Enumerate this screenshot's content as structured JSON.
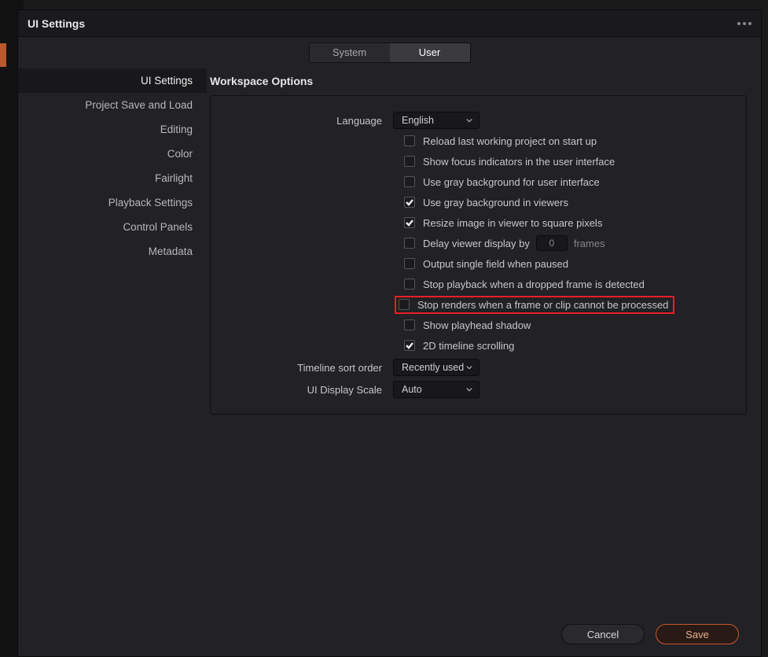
{
  "window": {
    "title": "UI Settings"
  },
  "tabs": {
    "system": "System",
    "user": "User"
  },
  "sidebar": {
    "items": [
      {
        "label": "UI Settings"
      },
      {
        "label": "Project Save and Load"
      },
      {
        "label": "Editing"
      },
      {
        "label": "Color"
      },
      {
        "label": "Fairlight"
      },
      {
        "label": "Playback Settings"
      },
      {
        "label": "Control Panels"
      },
      {
        "label": "Metadata"
      }
    ]
  },
  "section": {
    "title": "Workspace Options"
  },
  "options": {
    "language_label": "Language",
    "language_value": "English",
    "reload": "Reload last working project on start up",
    "focus": "Show focus indicators in the user interface",
    "gray_ui": "Use gray background for user interface",
    "gray_viewers": "Use gray background in viewers",
    "resize": "Resize image in viewer to square pixels",
    "delay_label": "Delay viewer display by",
    "delay_value": "0",
    "delay_unit": "frames",
    "single_field": "Output single field when paused",
    "stop_dropped": "Stop playback when a dropped frame is detected",
    "stop_renders": "Stop renders when a frame or clip cannot be processed",
    "playhead_shadow": "Show playhead shadow",
    "timeline_scroll": "2D timeline scrolling",
    "sort_label": "Timeline sort order",
    "sort_value": "Recently used",
    "scale_label": "UI Display Scale",
    "scale_value": "Auto"
  },
  "footer": {
    "cancel": "Cancel",
    "save": "Save"
  }
}
